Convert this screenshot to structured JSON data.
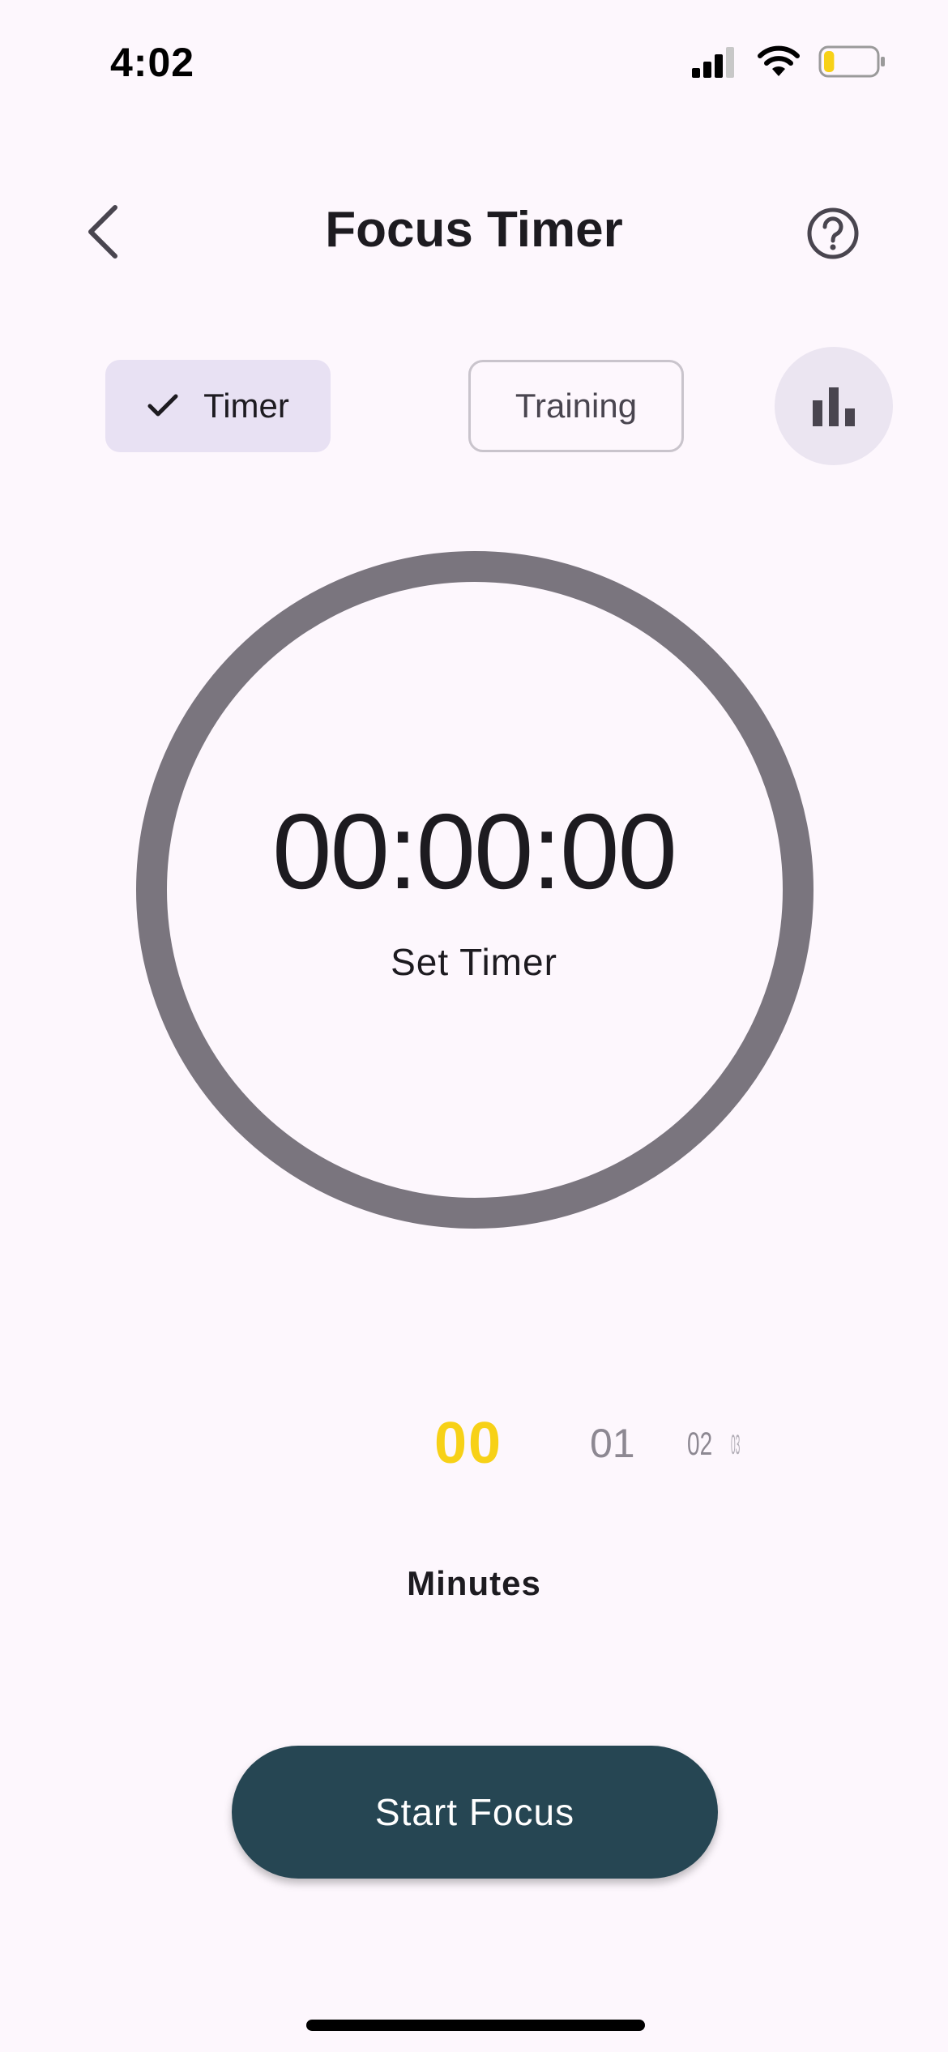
{
  "status_bar": {
    "time": "4:02",
    "battery_level_percent": 20,
    "battery_color": "#f7d117"
  },
  "app_bar": {
    "title": "Focus Timer"
  },
  "tabs": {
    "timer_label": "Timer",
    "training_label": "Training",
    "selected": "Timer"
  },
  "timer": {
    "display": "00:00:00",
    "status_label": "Set Timer",
    "ring_color": "#7a757e"
  },
  "picker": {
    "selected_value": "00",
    "next_values": [
      "01",
      "02",
      "03"
    ],
    "unit_label": "Minutes",
    "highlight_color": "#f7d117"
  },
  "primary_action": {
    "label": "Start Focus",
    "color": "#264653"
  },
  "icons": {
    "back": "chevron-left-icon",
    "help": "help-circle-icon",
    "check": "check-icon",
    "stats": "bar-chart-icon"
  }
}
